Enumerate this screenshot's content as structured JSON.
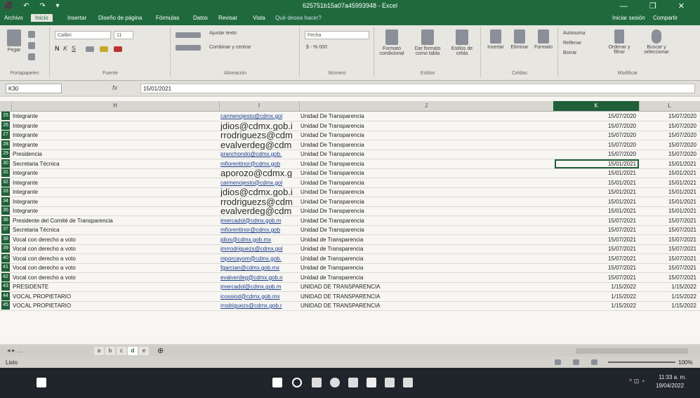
{
  "window": {
    "title": "625751b15a07a45993948 - Excel",
    "controls": "—  ❐  ✕"
  },
  "quick_access": "⬛ ↶ ↷ ▾",
  "menu_tabs": [
    "Archivo",
    "Inicio",
    "Insertar",
    "Diseño de página",
    "Fórmulas",
    "Datos",
    "Revisar",
    "Vista",
    "Qué desea hacer?"
  ],
  "account": {
    "signin": "Iniciar sesión",
    "share": "Compartir"
  },
  "ribbon": {
    "paste": "Pegar",
    "font_name": "Calibri",
    "font_size": "11",
    "wrap_text": "Ajustar texto",
    "merge_center": "Combinar y centrar",
    "number_format": "Fecha",
    "currency": "$ - % 000",
    "conditional_format": "Formato condicional",
    "format_table": "Dar formato como tabla",
    "cell_styles": "Estilos de celda",
    "insert": "Insertar",
    "delete": "Eliminar",
    "format": "Formato",
    "autosum": "Autosuma",
    "fill": "Rellenar",
    "clear": "Borrar",
    "sort_filter": "Ordenar y filtrar",
    "find_select": "Buscar y seleccionar",
    "groups": {
      "clipboard": "Portapapeles",
      "font": "Fuente",
      "alignment": "Alineación",
      "number": "Número",
      "styles": "Estilos",
      "cells": "Celdas",
      "editing": "Modificar"
    }
  },
  "formula_bar": {
    "cell": "K30",
    "fx": "fx",
    "value": "15/01/2021"
  },
  "columns": {
    "h": "H",
    "i": "I",
    "j": "J",
    "k": "K",
    "l": "L"
  },
  "rows": [
    {
      "n": "25",
      "h": "Integrante",
      "i": "carmenojesto@cdmx.gol",
      "j": "Unidad De Transparencia",
      "k": "15/07/2020",
      "l": "15/07/2020",
      "big": false
    },
    {
      "n": "26",
      "h": "Integrante",
      "i": "jdios@cdmx.gob.i",
      "j": "Unidad De Transparencia",
      "k": "15/07/2020",
      "l": "15/07/2020",
      "big": true
    },
    {
      "n": "27",
      "h": "Integrante",
      "i": "rrodriguezs@cdm",
      "j": "Unidad De Transparencia",
      "k": "15/07/2020",
      "l": "15/07/2020",
      "big": true
    },
    {
      "n": "28",
      "h": "Integrante",
      "i": "evalverdeg@cdm",
      "j": "Unidad De Transparencia",
      "k": "15/07/2020",
      "l": "15/07/2020",
      "big": true
    },
    {
      "n": "29",
      "h": "Presidencia",
      "i": "pranchondo@cdmx.gob.",
      "j": "Unidad De Transparencia",
      "k": "15/07/2020",
      "l": "15/07/2020",
      "big": false
    },
    {
      "n": "30",
      "h": "Secretaria Técnica",
      "i": "mfiorentinor@cdmx.gob",
      "j": "Unidad De Transparencia",
      "k": "15/01/2021",
      "l": "15/01/2021",
      "big": false
    },
    {
      "n": "31",
      "h": "Integrante",
      "i": "aporozo@cdmx.g",
      "j": "Unidad De Transparencia",
      "k": "15/01/2021",
      "l": "15/01/2021",
      "big": true
    },
    {
      "n": "32",
      "h": "Integrante",
      "i": "carmenojesto@cdmx.gol",
      "j": "Unidad De Transparencia",
      "k": "15/01/2021",
      "l": "15/01/2021",
      "big": false
    },
    {
      "n": "33",
      "h": "Integrante",
      "i": "jdios@cdmx.gob.i",
      "j": "Unidad De Transparencia",
      "k": "15/01/2021",
      "l": "15/01/2021",
      "big": true
    },
    {
      "n": "34",
      "h": "Integrante",
      "i": "rrodriguezs@cdm",
      "j": "Unidad De Transparencia",
      "k": "15/01/2021",
      "l": "15/01/2021",
      "big": true
    },
    {
      "n": "35",
      "h": "Integrante",
      "i": "evalverdeg@cdm",
      "j": "Unidad De Transparencia",
      "k": "15/01/2021",
      "l": "15/01/2021",
      "big": true
    },
    {
      "n": "36",
      "h": "Presidente del Comité de Transparencia",
      "i": "jmercadol@cdmx.gob.m",
      "j": "Unidad De Transparencia",
      "k": "15/07/2021",
      "l": "15/07/2021",
      "big": false
    },
    {
      "n": "37",
      "h": "Secretaria Técnica",
      "i": "mfiorentinor@cdmx.gob",
      "j": "Unidad De Transparencia",
      "k": "15/07/2021",
      "l": "15/07/2021",
      "big": false
    },
    {
      "n": "38",
      "h": "Vocal con derecho a voto",
      "i": "jdios@cdmx.gob.mx",
      "j": "Unidad de Transparencia",
      "k": "15/07/2021",
      "l": "15/07/2021",
      "big": false
    },
    {
      "n": "39",
      "h": "Vocal con derecho a voto",
      "i": "jmrrodriguezs@cdmx.gol",
      "j": "Unidad de Transparencia",
      "k": "15/07/2021",
      "l": "15/07/2021",
      "big": false
    },
    {
      "n": "40",
      "h": "Vocal con derecho a voto",
      "i": "mporcayom@cdmx.gob.",
      "j": "Unidad de Transparencia",
      "k": "15/07/2021",
      "l": "15/07/2021",
      "big": false
    },
    {
      "n": "41",
      "h": "Vocal con derecho a voto",
      "i": "fgarcian@cdmx.gob.mx",
      "j": "Unidad de Transparencia",
      "k": "15/07/2021",
      "l": "15/07/2021",
      "big": false
    },
    {
      "n": "42",
      "h": "Vocal con derecho a voto",
      "i": "evalverdeg@cdmx.gob.n",
      "j": "Unidad de Transparencia",
      "k": "15/07/2021",
      "l": "15/07/2021",
      "big": false
    },
    {
      "n": "43",
      "h": "PRESIDENTE",
      "i": "jmercadol@cdmx.gob.m",
      "j": "UNIDAD DE TRANSPARENCIA",
      "k": "1/15/2022",
      "l": "1/15/2022",
      "big": false
    },
    {
      "n": "44",
      "h": "VOCAL PROPIETARIO",
      "i": "icossiod@cdmx.gob.mx",
      "j": "UNIDAD DE TRANSPARENCIA",
      "k": "1/15/2022",
      "l": "1/15/2022",
      "big": false
    },
    {
      "n": "45",
      "h": "VOCAL PROPIETARIO",
      "i": "rrodriguezs@cdmx.gob.r",
      "j": "UNIDAD DE TRANSPARENCIA",
      "k": "1/15/2022",
      "l": "1/15/2022",
      "big": false
    }
  ],
  "sheet_tabs": [
    "a",
    "b",
    "c",
    "d",
    "e"
  ],
  "add_sheet": "⊕",
  "status": {
    "ready": "Listo",
    "zoom": "100%"
  },
  "taskbar": {
    "time": "11:33 a. m.",
    "date": "19/04/2022"
  },
  "colors": {
    "excel_green": "#1f6a3d",
    "header_green": "#1f5f39"
  }
}
